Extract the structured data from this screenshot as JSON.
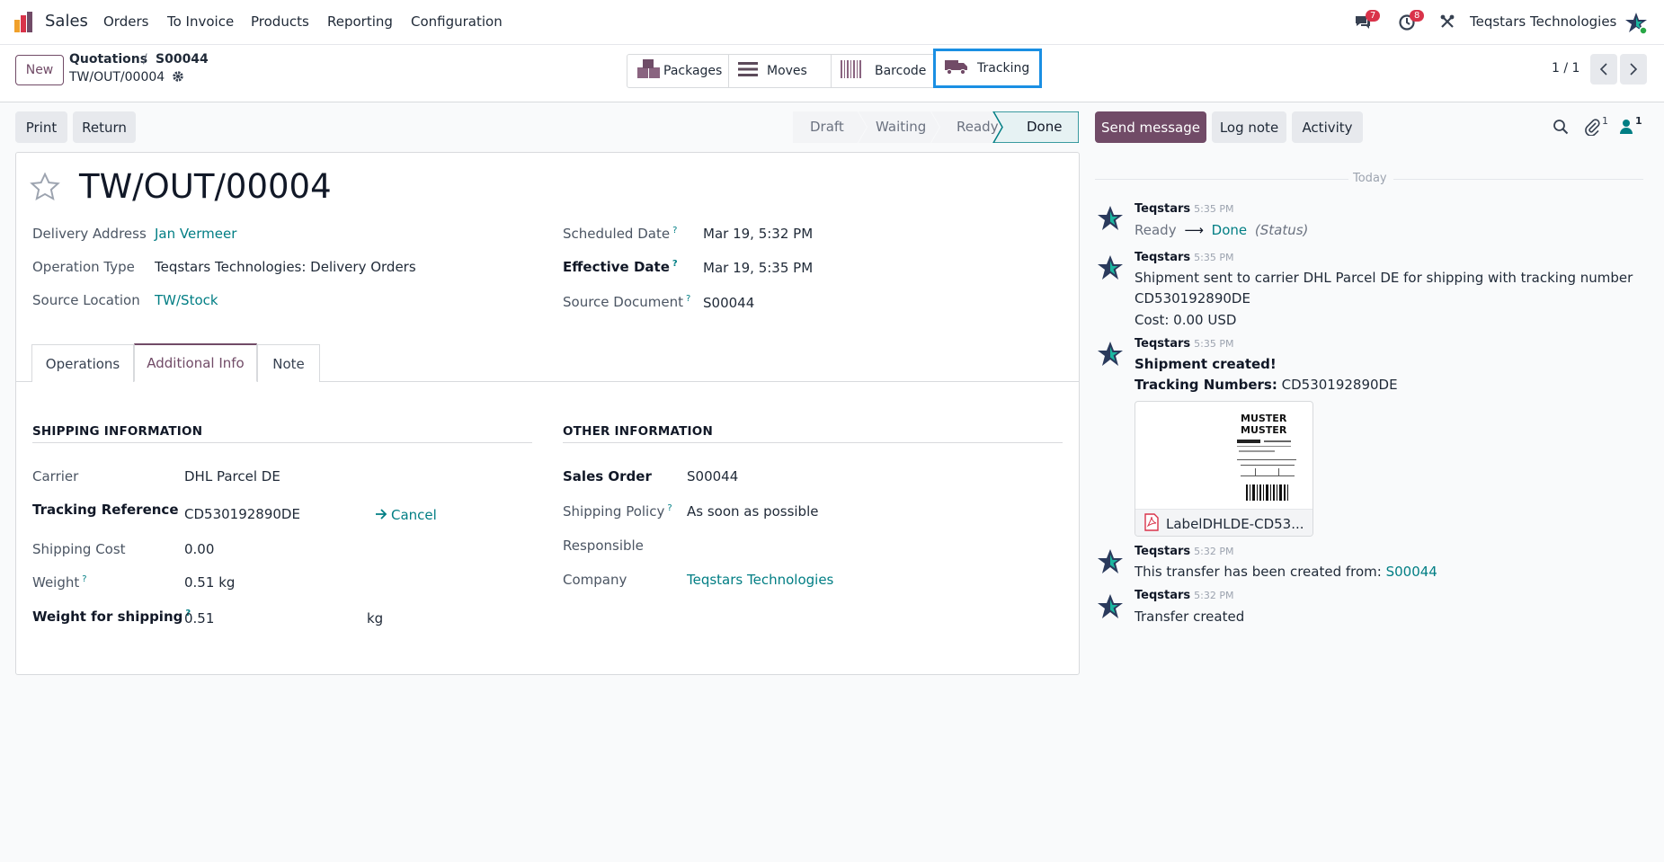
{
  "navbar": {
    "app_name": "Sales",
    "menu": [
      "Orders",
      "To Invoice",
      "Products",
      "Reporting",
      "Configuration"
    ],
    "messages_count": "7",
    "activities_count": "8",
    "company": "Teqstars Technologies"
  },
  "control_panel": {
    "new_label": "New",
    "breadcrumb_parent": "Quotations",
    "breadcrumb_sep": "/",
    "breadcrumb_order": "S00044",
    "record_name": "TW/OUT/00004",
    "smart_buttons": {
      "packages": "Packages",
      "moves": "Moves",
      "barcode": "Barcode",
      "tracking": "Tracking"
    },
    "pager": "1 / 1"
  },
  "actions": {
    "print": "Print",
    "return": "Return"
  },
  "statusbar": [
    "Draft",
    "Waiting",
    "Ready",
    "Done"
  ],
  "form": {
    "title": "TW/OUT/00004",
    "delivery_address_label": "Delivery Address",
    "delivery_address": "Jan Vermeer",
    "operation_type_label": "Operation Type",
    "operation_type": "Teqstars Technologies: Delivery Orders",
    "source_location_label": "Source Location",
    "source_location": "TW/Stock",
    "scheduled_date_label": "Scheduled Date",
    "scheduled_date": "Mar 19, 5:32 PM",
    "effective_date_label": "Effective Date",
    "effective_date": "Mar 19, 5:35 PM",
    "source_document_label": "Source Document",
    "source_document": "S00044",
    "q_mark": "?",
    "tabs": [
      "Operations",
      "Additional Info",
      "Note"
    ],
    "shipping": {
      "title": "SHIPPING INFORMATION",
      "carrier_label": "Carrier",
      "carrier": "DHL Parcel DE",
      "tracking_label": "Tracking Reference",
      "tracking": "CD530192890DE",
      "cancel": "Cancel",
      "cost_label": "Shipping Cost",
      "cost": "0.00",
      "weight_label": "Weight",
      "weight": "0.51",
      "weight_unit": "kg",
      "weight_ship_label": "Weight for shipping",
      "weight_ship": "0.51",
      "weight_ship_unit": "kg"
    },
    "other": {
      "title": "OTHER INFORMATION",
      "sales_order_label": "Sales Order",
      "sales_order": "S00044",
      "policy_label": "Shipping Policy",
      "policy": "As soon as possible",
      "responsible_label": "Responsible",
      "company_label": "Company",
      "company": "Teqstars Technologies"
    }
  },
  "chatter": {
    "send_message": "Send message",
    "log_note": "Log note",
    "activity": "Activity",
    "attachments_count": "1",
    "followers_count": "1",
    "today": "Today",
    "messages": [
      {
        "author": "Teqstars",
        "time": "5:35 PM",
        "from": "Ready",
        "arrow": "⟶",
        "to": "Done",
        "field": "(Status)"
      },
      {
        "author": "Teqstars",
        "time": "5:35 PM",
        "line1": "Shipment sent to carrier DHL Parcel DE for shipping with tracking number",
        "line2": "CD530192890DE",
        "line3": "Cost: 0.00 USD"
      },
      {
        "author": "Teqstars",
        "time": "5:35 PM",
        "bold": "Shipment created!",
        "tracking_label": "Tracking Numbers:",
        "tracking": "CD530192890DE",
        "attachment": "LabelDHLDE-CD53...",
        "label_text_1": "MUSTER",
        "label_text_2": "MUSTER"
      },
      {
        "author": "Teqstars",
        "time": "5:32 PM",
        "text": "This transfer has been created from:",
        "link": "S00044"
      },
      {
        "author": "Teqstars",
        "time": "5:32 PM",
        "text": "Transfer created"
      }
    ]
  },
  "colors": {
    "brand": "#714b67",
    "link": "#017e84",
    "highlight": "#1a8fe3",
    "badge": "#d9334a"
  }
}
